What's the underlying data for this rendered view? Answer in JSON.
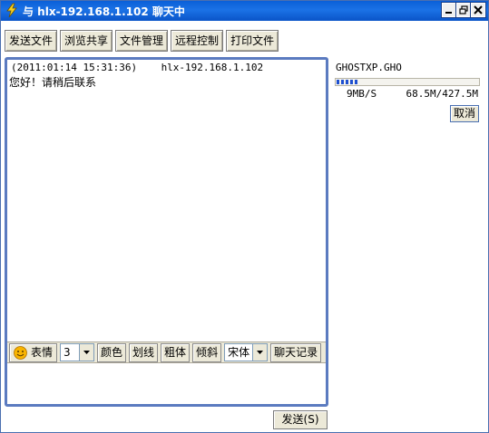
{
  "window": {
    "title": "与 hlx-192.168.1.102 聊天中",
    "icon": "lightning-icon"
  },
  "toolbar": {
    "buttons": [
      "发送文件",
      "浏览共享",
      "文件管理",
      "远程控制",
      "打印文件"
    ]
  },
  "chat": {
    "messages": [
      {
        "header": "(2011:01:14 15:31:36)    hlx-192.168.1.102",
        "text": "您好！请稍后联系"
      }
    ]
  },
  "format_bar": {
    "emoji_label": "表情",
    "font_size": "3",
    "color_label": "颜色",
    "underline_label": "划线",
    "bold_label": "粗体",
    "italic_label": "倾斜",
    "font_name": "宋体",
    "history_label": "聊天记录"
  },
  "send": {
    "label": "发送",
    "accesskey": "(S)"
  },
  "transfer": {
    "file_name": "GHOSTXP.GHO",
    "progress": 0.16,
    "speed": "9MB/S",
    "size": "68.5M/427.5M",
    "cancel_label": "取消"
  },
  "colors": {
    "title_bar": "#0a5fd8",
    "chat_border": "#5b7bc0",
    "button_face": "#ece9d8",
    "progress": "#1e4fd0"
  }
}
